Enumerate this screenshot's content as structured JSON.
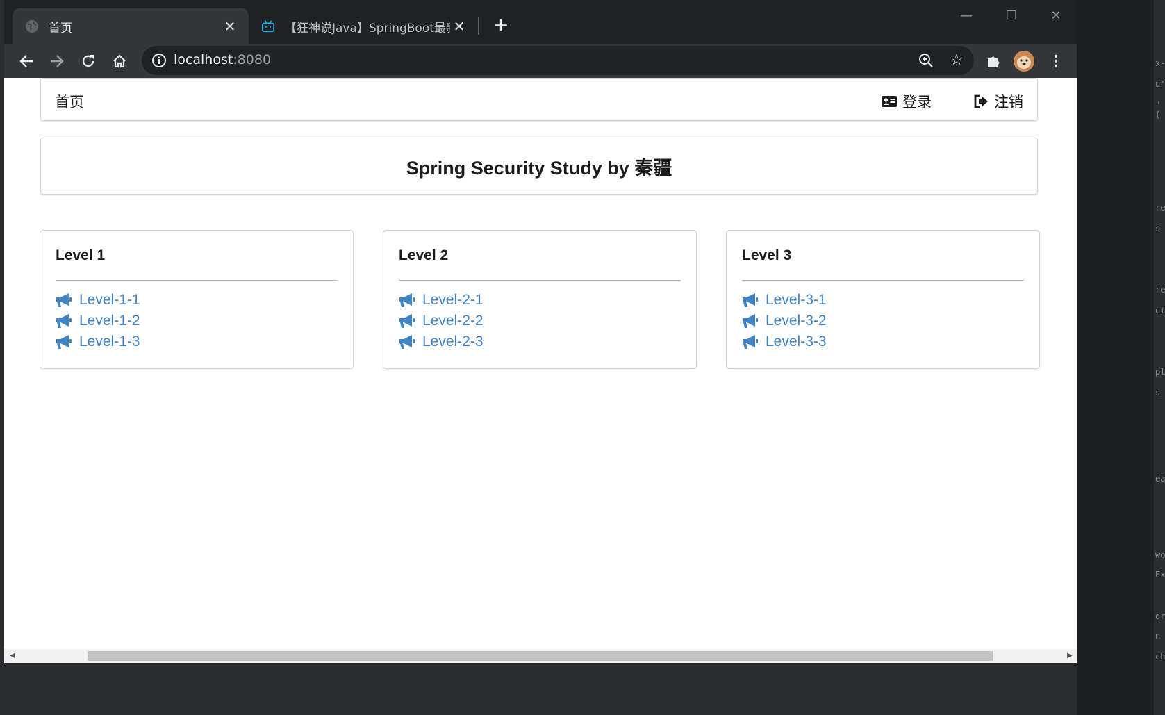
{
  "browser": {
    "tabs": [
      {
        "title": "首页",
        "active": true,
        "favicon": "globe-icon"
      },
      {
        "title": "【狂神说Java】SpringBoot最新",
        "active": false,
        "favicon": "bilibili-icon"
      }
    ],
    "url_host": "localhost",
    "url_port": ":8080",
    "toolbar_icons": [
      "back-arrow-icon",
      "forward-arrow-icon",
      "reload-icon",
      "home-icon",
      "zoom-icon",
      "star-icon",
      "extensions-icon",
      "profile-avatar",
      "menu-dots-icon"
    ]
  },
  "nav": {
    "home_label": "首页",
    "login_label": "登录",
    "logout_label": "注销"
  },
  "header": {
    "title": "Spring Security Study by 秦疆"
  },
  "levels": [
    {
      "title": "Level 1",
      "links": [
        "Level-1-1",
        "Level-1-2",
        "Level-1-3"
      ]
    },
    {
      "title": "Level 2",
      "links": [
        "Level-2-1",
        "Level-2-2",
        "Level-2-3"
      ]
    },
    {
      "title": "Level 3",
      "links": [
        "Level-3-1",
        "Level-3-2",
        "Level-3-3"
      ]
    }
  ],
  "colors": {
    "link": "#4183c4",
    "browser_dark": "#202124",
    "toolbar": "#35363a"
  },
  "ide_fragments": [
    "x-",
    "u'",
    "\"(",
    "re",
    "s",
    "re",
    "ut",
    "pl",
    "s",
    "ea",
    "wo",
    "Ex",
    "or",
    "n",
    "ch"
  ]
}
